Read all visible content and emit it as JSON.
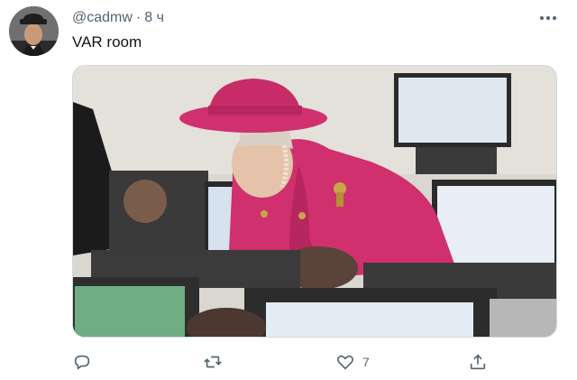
{
  "tweet": {
    "handle": "@cadmw",
    "separator": "·",
    "time": "8 ч",
    "text": "VAR room",
    "avatar": "profile-photo",
    "more_icon": "more-dots-icon"
  },
  "media": {
    "image": "photo-woman-in-pink-coat-and-hat-leaning-over-computers"
  },
  "actions": {
    "reply_icon": "reply-icon",
    "retweet_icon": "retweet-icon",
    "like_icon": "heart-icon",
    "like_count": "7",
    "share_icon": "share-icon"
  },
  "colors": {
    "text": "#0f1419",
    "muted": "#536471",
    "border": "#cfd9de",
    "coat": "#d0306d"
  }
}
